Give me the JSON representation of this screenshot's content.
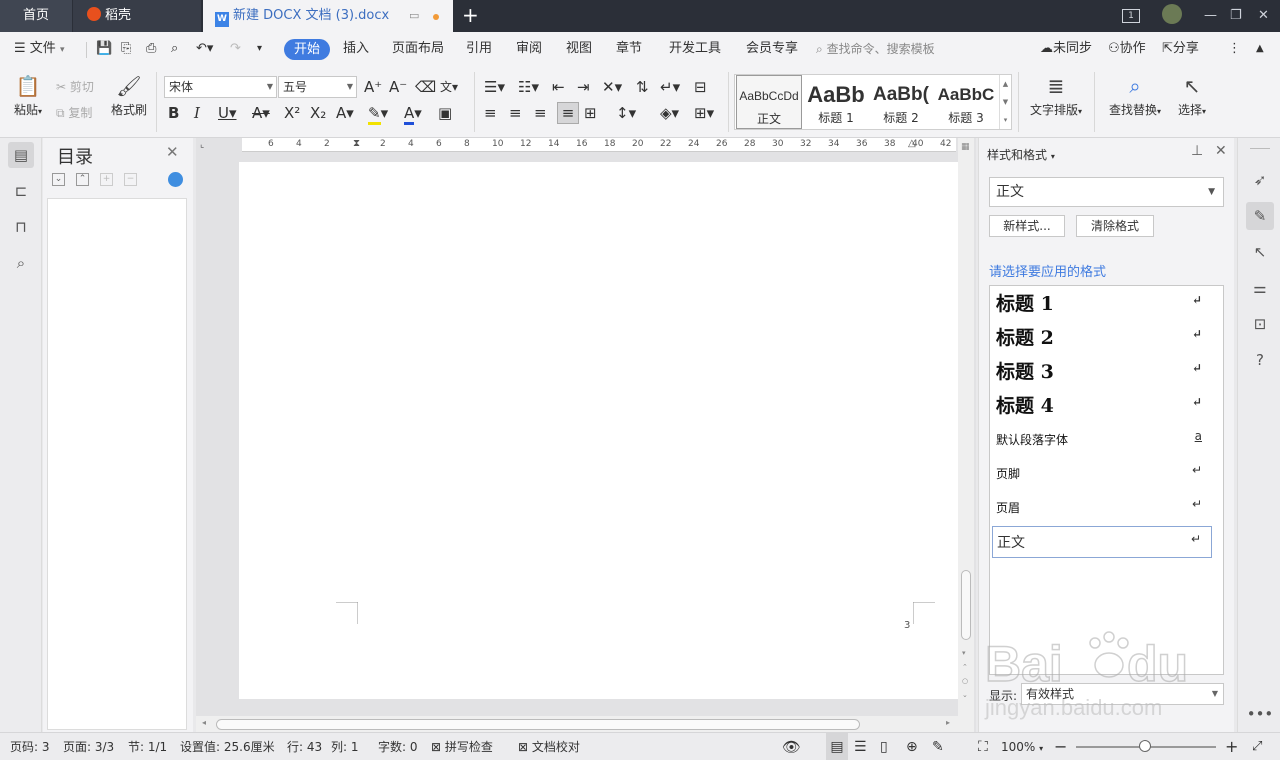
{
  "titlebar": {
    "home_tab": "首页",
    "daoke_tab": "稻壳",
    "doc_tab": "新建 DOCX 文档 (3).docx",
    "window_badge": "1"
  },
  "menubar": {
    "file": "文件",
    "items": [
      "开始",
      "插入",
      "页面布局",
      "引用",
      "审阅",
      "视图",
      "章节",
      "开发工具",
      "会员专享"
    ],
    "search_placeholder": "查找命令、搜索模板",
    "sync": "未同步",
    "collab": "协作",
    "share": "分享"
  },
  "ribbon": {
    "paste": "粘贴",
    "cut": "剪切",
    "copy": "复制",
    "format_painter": "格式刷",
    "font_name": "宋体",
    "font_size": "五号",
    "styles": [
      {
        "preview": "AaBbCcDd",
        "name": "正文"
      },
      {
        "preview": "AaBb",
        "name": "标题 1"
      },
      {
        "preview": "AaBb(",
        "name": "标题 2"
      },
      {
        "preview": "AaBbC",
        "name": "标题 3"
      }
    ],
    "text_layout": "文字排版",
    "find_replace": "查找替换",
    "select": "选择"
  },
  "toc": {
    "title": "目录"
  },
  "ruler": {
    "ticks": [
      "6",
      "4",
      "2",
      "2",
      "4",
      "6",
      "8",
      "10",
      "12",
      "14",
      "16",
      "18",
      "20",
      "22",
      "24",
      "26",
      "28",
      "30",
      "32",
      "34",
      "36",
      "38",
      "40",
      "42"
    ]
  },
  "document": {
    "page_number": "3"
  },
  "style_panel": {
    "title": "样式和格式",
    "current_style": "正文",
    "new_style": "新样式...",
    "clear_format": "清除格式",
    "hint": "请选择要应用的格式",
    "styles": [
      {
        "name": "标题  1",
        "mark": "↵",
        "kind": "h"
      },
      {
        "name": "标题  2",
        "mark": "↵",
        "kind": "h"
      },
      {
        "name": "标题  3",
        "mark": "↵",
        "kind": "h"
      },
      {
        "name": "标题  4",
        "mark": "↵",
        "kind": "h"
      },
      {
        "name": "默认段落字体",
        "mark": "a",
        "kind": "n"
      },
      {
        "name": "页脚",
        "mark": "↵",
        "kind": "n"
      },
      {
        "name": "页眉",
        "mark": "↵",
        "kind": "n"
      },
      {
        "name": "正文",
        "mark": "↵",
        "kind": "sel"
      }
    ],
    "show_label": "显示:",
    "show_value": "有效样式"
  },
  "statusbar": {
    "page": "页码: 3",
    "pages": "页面: 3/3",
    "section": "节: 1/1",
    "setting": "设置值: 25.6厘米",
    "row": "行: 43",
    "col": "列: 1",
    "words": "字数: 0",
    "spellcheck": "拼写检查",
    "proofread": "文档校对",
    "zoom": "100%"
  },
  "watermark": {
    "text": "jingyan.baidu.com"
  },
  "colors": {
    "accent": "#3f7be0",
    "titlebar": "#2b2f38"
  }
}
